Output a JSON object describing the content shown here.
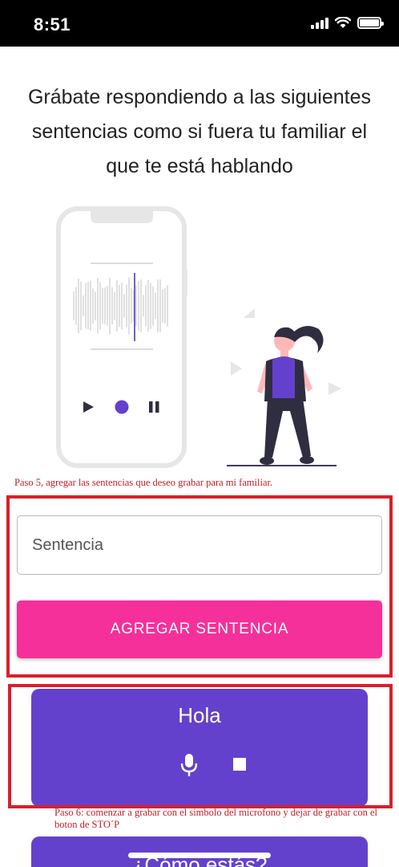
{
  "status_bar": {
    "time": "8:51"
  },
  "title": "Grábate respondiendo a las siguientes sentencias como si fuera tu familiar el que te está hablando",
  "annotations": {
    "step5": "Paso 5, agregar las sentencias que deseo grabar para mi familiar.",
    "step6": "Paso 6: comenzar a grabar con el simbolo del microfono y dejar de grabar con el boton de STO´P"
  },
  "form": {
    "sentence_placeholder": "Sentencia",
    "add_button": "AGREGAR SENTENCIA"
  },
  "sentences": [
    {
      "text": "Hola"
    },
    {
      "text": "¿Cómo estás?"
    }
  ],
  "colors": {
    "accent_purple": "#6441cd",
    "accent_pink": "#f5309a",
    "annotation_red": "#d8202a"
  }
}
